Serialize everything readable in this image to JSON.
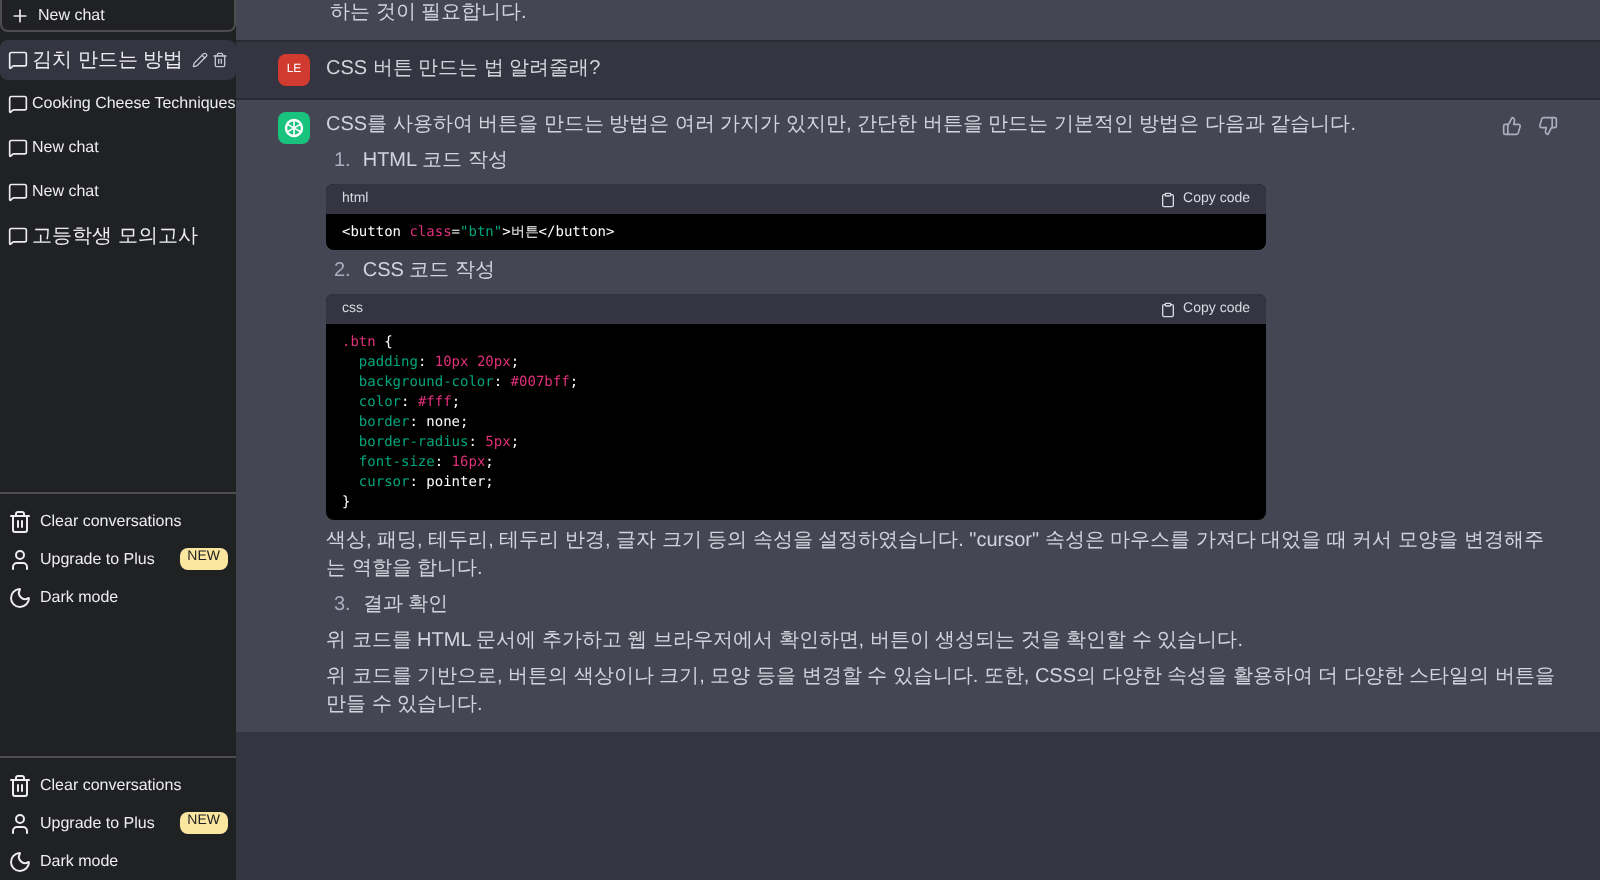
{
  "sidebar": {
    "new_chat": "New chat",
    "conversations": [
      {
        "title": "김치 만드는 방법",
        "selected": true
      },
      {
        "title": "Cooking Cheese Techniques",
        "selected": false
      },
      {
        "title": "New chat",
        "selected": false
      },
      {
        "title": "New chat",
        "selected": false
      },
      {
        "title": "고등학생 모의고사",
        "selected": false
      }
    ],
    "menus": [
      {
        "items": [
          {
            "kind": "trash",
            "label": "Clear conversations"
          },
          {
            "kind": "user",
            "label": "Upgrade to Plus",
            "badge": "NEW"
          },
          {
            "kind": "moon",
            "label": "Dark mode"
          }
        ]
      },
      {
        "items": [
          {
            "kind": "trash",
            "label": "Clear conversations"
          },
          {
            "kind": "user",
            "label": "Upgrade to Plus",
            "badge": "NEW"
          },
          {
            "kind": "moon",
            "label": "Dark mode"
          }
        ]
      }
    ]
  },
  "chat": {
    "previous_text": "하는 것이 필요합니다.",
    "user_message": {
      "avatar": "LE",
      "text": "CSS 버튼 만드는 법 알려줄래?"
    },
    "answer": {
      "intro": "CSS를 사용하여 버튼을 만드는 방법은 여러 가지가 있지만, 간단한 버튼을 만드는 기본적인 방법은 다음과 같습니다.",
      "blocks": [
        {
          "kind": "step",
          "number": "1.",
          "text": "HTML 코드 작성"
        },
        {
          "kind": "code",
          "language": "html",
          "copy_label": "Copy code",
          "lines": [
            "<button class=\"btn\">버튼</button>"
          ]
        },
        {
          "kind": "step",
          "number": "2.",
          "text": "CSS 코드 작성"
        },
        {
          "kind": "code",
          "language": "css",
          "copy_label": "Copy code",
          "lines": [
            ".btn {",
            "  padding: 10px 20px;",
            "  background-color: #007bff;",
            "  color: #fff;",
            "  border: none;",
            "  border-radius: 5px;",
            "  font-size: 16px;",
            "  cursor: pointer;",
            "}"
          ]
        },
        {
          "kind": "paragraph",
          "text": "색상, 패딩, 테두리, 테두리 반경, 글자 크기 등의 속성을 설정하였습니다. \"cursor\" 속성은 마우스를 가져다 대었을 때 커서 모양을 변경해주는 역할을 합니다."
        },
        {
          "kind": "step",
          "number": "3.",
          "text": "결과 확인"
        },
        {
          "kind": "paragraph",
          "text": "위 코드를 HTML 문서에 추가하고 웹 브라우저에서 확인하면, 버튼이 생성되는 것을 확인할 수 있습니다."
        },
        {
          "kind": "paragraph",
          "text": "위 코드를 기반으로, 버튼의 색상이나 크기, 모양 등을 변경할 수 있습니다. 또한, CSS의 다양한 속성을 활용하여 더 다양한 스타일의 버튼을 만들 수 있습니다."
        }
      ]
    }
  }
}
